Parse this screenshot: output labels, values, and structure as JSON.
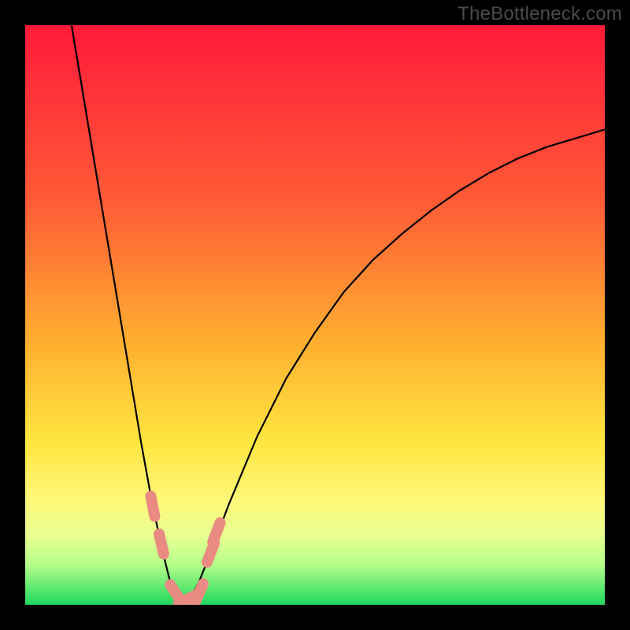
{
  "watermark": "TheBottleneck.com",
  "chart_data": {
    "type": "line",
    "title": "",
    "xlabel": "",
    "ylabel": "",
    "xlim": [
      0,
      100
    ],
    "ylim": [
      0,
      100
    ],
    "grid": false,
    "background_gradient": {
      "stops": [
        {
          "offset": 0.0,
          "color": "#ff1a3a"
        },
        {
          "offset": 0.3,
          "color": "#ff5a36"
        },
        {
          "offset": 0.55,
          "color": "#ffb030"
        },
        {
          "offset": 0.72,
          "color": "#ffe640"
        },
        {
          "offset": 0.82,
          "color": "#fff87a"
        },
        {
          "offset": 0.88,
          "color": "#e8ff90"
        },
        {
          "offset": 0.93,
          "color": "#b6ff8a"
        },
        {
          "offset": 1.0,
          "color": "#1fd85f"
        }
      ]
    },
    "series": [
      {
        "name": "bottleneck-curve",
        "color": "#000000",
        "x": [
          8,
          10,
          12,
          14,
          16,
          18,
          20,
          22,
          24,
          25,
          26,
          27,
          28,
          29,
          30,
          32,
          35,
          40,
          45,
          50,
          55,
          60,
          65,
          70,
          75,
          80,
          85,
          90,
          95,
          100
        ],
        "y": [
          100,
          88,
          76,
          64,
          52,
          40,
          28,
          17,
          8,
          4,
          2,
          1,
          1,
          2,
          4,
          9,
          17,
          29,
          39,
          47,
          54,
          59.5,
          64,
          68,
          71.5,
          74.5,
          77,
          79,
          80.5,
          82
        ]
      }
    ],
    "markers": [
      {
        "name": "left-upper",
        "x": 22.0,
        "y": 17.0,
        "color": "#e98b82"
      },
      {
        "name": "left-lower",
        "x": 23.5,
        "y": 10.5,
        "color": "#e98b82"
      },
      {
        "name": "bottom-a",
        "x": 26.0,
        "y": 2.0,
        "color": "#e98b82"
      },
      {
        "name": "bottom-b",
        "x": 28.0,
        "y": 1.0,
        "color": "#e98b82"
      },
      {
        "name": "bottom-c",
        "x": 30.0,
        "y": 2.0,
        "color": "#e98b82"
      },
      {
        "name": "right-lower",
        "x": 32.0,
        "y": 9.0,
        "color": "#e98b82"
      },
      {
        "name": "right-upper",
        "x": 33.0,
        "y": 12.5,
        "color": "#e98b82"
      }
    ]
  }
}
